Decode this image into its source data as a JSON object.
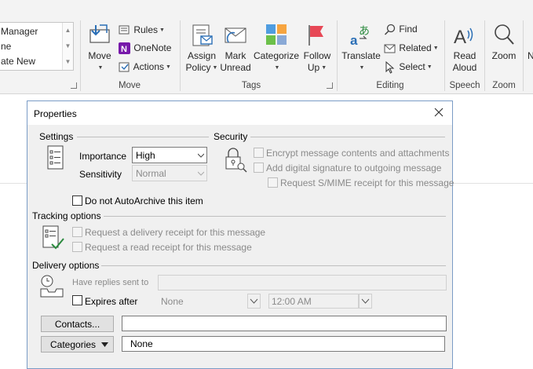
{
  "ribbon": {
    "quick_steps": [
      "Manager",
      "ne",
      "ate New"
    ],
    "move_group": {
      "move_label": "Move",
      "rules_label": "Rules",
      "onenote_label": "OneNote",
      "actions_label": "Actions",
      "group_label": "Move"
    },
    "tags_group": {
      "assign_policy_line1": "Assign",
      "assign_policy_line2": "Policy",
      "mark_unread_line1": "Mark",
      "mark_unread_line2": "Unread",
      "categorize_label": "Categorize",
      "follow_up_line1": "Follow",
      "follow_up_line2": "Up",
      "group_label": "Tags"
    },
    "editing_group": {
      "translate_label": "Translate",
      "find_label": "Find",
      "related_label": "Related",
      "select_label": "Select",
      "group_label": "Editing"
    },
    "speech_group": {
      "read_aloud_line1": "Read",
      "read_aloud_line2": "Aloud",
      "group_label": "Speech"
    },
    "zoom_group": {
      "zoom_label": "Zoom",
      "group_label": "Zoom"
    },
    "overflow_letter": "N"
  },
  "dialog": {
    "title": "Properties",
    "settings": {
      "heading": "Settings",
      "importance_label": "Importance",
      "importance_value": "High",
      "sensitivity_label": "Sensitivity",
      "sensitivity_value": "Normal",
      "no_autoarchive_label": "Do not AutoArchive this item"
    },
    "security": {
      "heading": "Security",
      "encrypt_label": "Encrypt message contents and attachments",
      "signature_label": "Add digital signature to outgoing message",
      "smime_label": "Request S/MIME receipt for this message"
    },
    "tracking": {
      "heading": "Tracking options",
      "delivery_receipt_label": "Request a delivery receipt for this message",
      "read_receipt_label": "Request a read receipt for this message"
    },
    "delivery": {
      "heading": "Delivery options",
      "replies_label": "Have replies sent to",
      "replies_value": "",
      "expires_label": "Expires after",
      "expires_date": "None",
      "expires_time": "12:00 AM"
    },
    "contacts_button": "Contacts...",
    "contacts_value": "",
    "categories_button": "Categories",
    "categories_value": "None"
  },
  "colors": {
    "ribbon_bg": "#f3f3f3",
    "dialog_bg": "#f0f0f0",
    "dialog_border": "#7a9cc6",
    "icon_blue": "#2b6fb6",
    "followup_red": "#e74856"
  }
}
